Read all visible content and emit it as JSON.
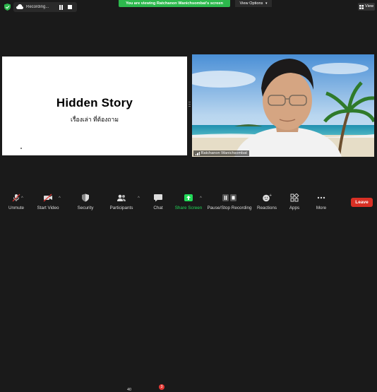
{
  "topbar": {
    "recording_label": "Recording...",
    "share_banner": "You are viewing Ratchanon Wanichsombat's screen",
    "view_options_label": "View Options",
    "view_label": "View"
  },
  "slide": {
    "title": "Hidden Story",
    "subtitle": "เรื่องเล่า ที่ต้องถาม"
  },
  "video": {
    "participant_name": "Ratchanon Wanichsombat"
  },
  "toolbar": {
    "unmute": "Unmute",
    "start_video": "Start Video",
    "security": "Security",
    "participants": "Participants",
    "participants_count": "40",
    "chat": "Chat",
    "chat_badge": "3",
    "share_screen": "Share Screen",
    "pause_recording": "Pause/Stop Recording",
    "reactions": "Reactions",
    "apps": "Apps",
    "more": "More",
    "leave": "Leave"
  },
  "colors": {
    "banner_green": "#2db94d",
    "leave_red": "#d93025",
    "share_green": "#23d959",
    "background": "#1a1a1a"
  }
}
